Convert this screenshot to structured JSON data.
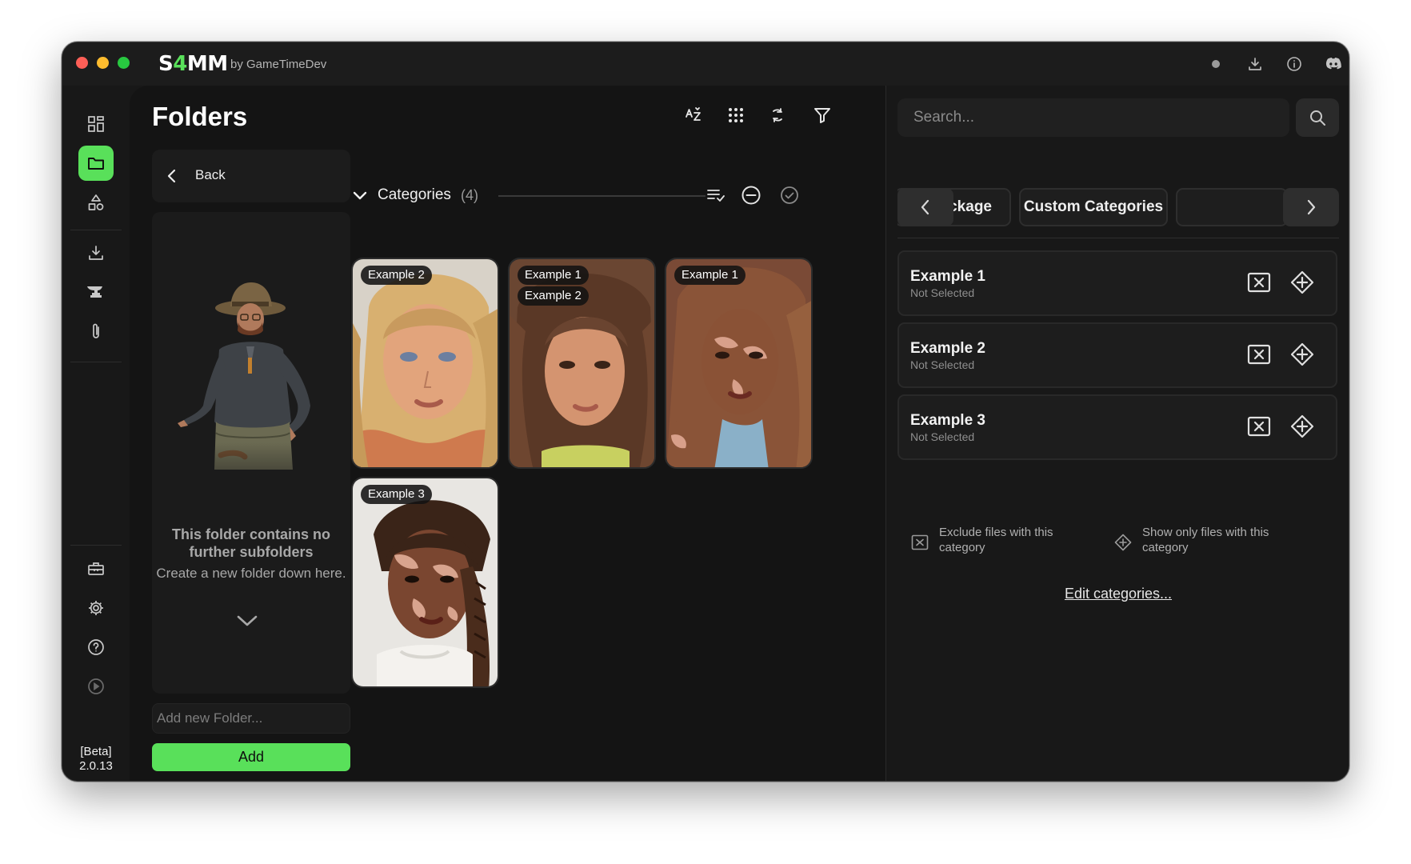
{
  "app": {
    "brand_s": "S",
    "brand_4": "4",
    "brand_mm": "MM",
    "byline": "by GameTimeDev",
    "version": "[Beta]\n2.0.13"
  },
  "titlebar_icons": [
    "status-dot-icon",
    "download-icon",
    "info-icon",
    "discord-icon"
  ],
  "sidebar": {
    "items": [
      "dashboard-icon",
      "folder-icon",
      "shapes-icon",
      "download-icon",
      "anvil-icon",
      "paperclip-icon",
      "toolbox-icon",
      "gear-icon",
      "help-icon",
      "play-icon"
    ],
    "active": "folder-icon"
  },
  "main": {
    "title": "Folders",
    "toolbar": [
      "sort-az-icon",
      "grid-icon",
      "refresh-icon",
      "filter-icon"
    ],
    "back_label": "Back",
    "empty_title": "This folder contains no further subfolders",
    "empty_hint": "Create a new folder down here.",
    "new_folder_placeholder": "Add new Folder...",
    "add_label": "Add",
    "categories": {
      "label": "Categories",
      "count": "(4)"
    },
    "cards": [
      {
        "tags": [
          "Example 2"
        ],
        "hair": "blonde"
      },
      {
        "tags": [
          "Example 1",
          "Example 2"
        ],
        "hair": "brown"
      },
      {
        "tags": [
          "Example 1"
        ],
        "hair": "brown-long"
      },
      {
        "tags": [
          "Example 3"
        ],
        "hair": "braid"
      }
    ]
  },
  "right": {
    "search_placeholder": "Search...",
    "tabs": [
      "Package",
      "Custom Categories"
    ],
    "rows": [
      {
        "title": "Example 1",
        "status": "Not Selected"
      },
      {
        "title": "Example 2",
        "status": "Not Selected"
      },
      {
        "title": "Example 3",
        "status": "Not Selected"
      }
    ],
    "legend_exclude": "Exclude files with this category",
    "legend_include": "Show only files with this category",
    "edit_link": "Edit categories..."
  },
  "colors": {
    "accent": "#59e05a",
    "bg": "#141414",
    "panel": "#1c1c1c"
  }
}
